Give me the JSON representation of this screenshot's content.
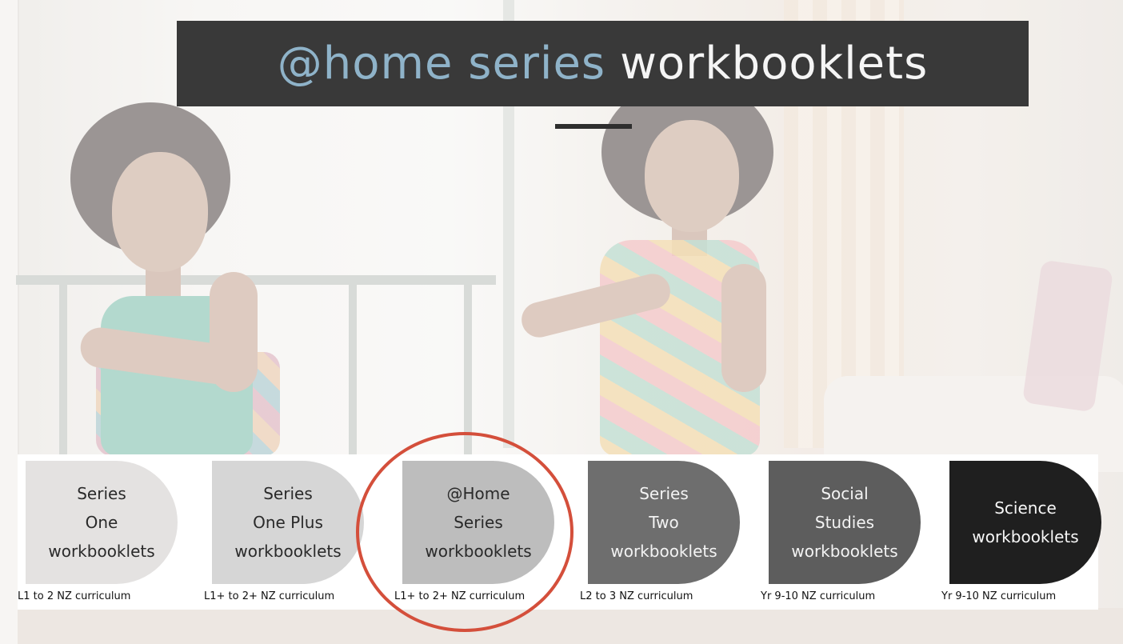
{
  "title": {
    "accent": "@home series",
    "rest": "workbooklets"
  },
  "cards": [
    {
      "label": "Series\nOne\nworkbooklets",
      "caption": "L1 to 2 NZ curriculum"
    },
    {
      "label": "Series\nOne Plus\nworkbooklets",
      "caption": "L1+ to 2+ NZ curriculum"
    },
    {
      "label": "@Home\nSeries\nworkbooklets",
      "caption": "L1+ to 2+ NZ curriculum"
    },
    {
      "label": "Series\nTwo\nworkbooklets",
      "caption": "L2 to 3 NZ curriculum"
    },
    {
      "label": "Social\nStudies\nworkbooklets",
      "caption": "Yr 9-10 NZ curriculum"
    },
    {
      "label": "Science\nworkbooklets",
      "caption": "Yr 9-10 NZ curriculum"
    }
  ],
  "colors": {
    "banner": "#393939",
    "accent_text": "#8fb3c9",
    "highlight_ring": "#d44f3b"
  }
}
